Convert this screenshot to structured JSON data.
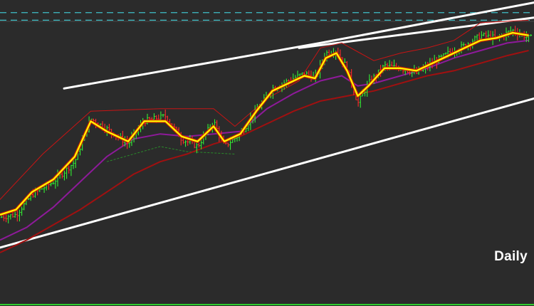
{
  "chart": {
    "timeframe": "Daily",
    "colors": {
      "background": "#2b2b2b",
      "frame": "#4a4a4a",
      "bottom_rule": "#2ecc2e",
      "up_bar": "#33ee33",
      "down_bar": "#ff2a2a",
      "ma_fast": "#ffff00",
      "ma_fast_edge": "#cc2200",
      "ma_mid": "#8e1a9a",
      "ma_slow": "#a01010",
      "envelope": "#c81414",
      "envelope_low": "#2a8a2a",
      "level_line": "#3fc0c8",
      "trend_line": "#ffffff"
    }
  },
  "chart_data": {
    "type": "line",
    "title": "",
    "xlabel": "",
    "ylabel": "",
    "xlim": [
      0,
      100
    ],
    "ylim": [
      0,
      100
    ],
    "grid": false,
    "legend": "none",
    "series": [
      {
        "role": "price",
        "points": [
          [
            0,
            14
          ],
          [
            3,
            15
          ],
          [
            6,
            23
          ],
          [
            10,
            28
          ],
          [
            14,
            36
          ],
          [
            17,
            53
          ],
          [
            20,
            49
          ],
          [
            24,
            43
          ],
          [
            27,
            52
          ],
          [
            31,
            54
          ],
          [
            34,
            45
          ],
          [
            37,
            42
          ],
          [
            40,
            52
          ],
          [
            42,
            42
          ],
          [
            45,
            47
          ],
          [
            48,
            56
          ],
          [
            51,
            65
          ],
          [
            54,
            68
          ],
          [
            57,
            71
          ],
          [
            59,
            69
          ],
          [
            61,
            79
          ],
          [
            63,
            80
          ],
          [
            65,
            73
          ],
          [
            67,
            59
          ],
          [
            69,
            67
          ],
          [
            72,
            74
          ],
          [
            75,
            73
          ],
          [
            78,
            71
          ],
          [
            81,
            75
          ],
          [
            84,
            79
          ],
          [
            87,
            82
          ],
          [
            90,
            86
          ],
          [
            93,
            85
          ],
          [
            96,
            88
          ],
          [
            99,
            85
          ]
        ]
      },
      {
        "role": "ma-fast",
        "points": [
          [
            0,
            15
          ],
          [
            3,
            17
          ],
          [
            6,
            24
          ],
          [
            10,
            29
          ],
          [
            14,
            38
          ],
          [
            17,
            52
          ],
          [
            20,
            48
          ],
          [
            24,
            44
          ],
          [
            27,
            52
          ],
          [
            31,
            52
          ],
          [
            34,
            46
          ],
          [
            37,
            44
          ],
          [
            40,
            50
          ],
          [
            42,
            44
          ],
          [
            45,
            47
          ],
          [
            48,
            56
          ],
          [
            51,
            64
          ],
          [
            54,
            67
          ],
          [
            57,
            70
          ],
          [
            59,
            69
          ],
          [
            61,
            77
          ],
          [
            63,
            79
          ],
          [
            65,
            72
          ],
          [
            67,
            62
          ],
          [
            69,
            66
          ],
          [
            72,
            73
          ],
          [
            75,
            73
          ],
          [
            78,
            72
          ],
          [
            81,
            75
          ],
          [
            84,
            78
          ],
          [
            87,
            81
          ],
          [
            90,
            84
          ],
          [
            93,
            85
          ],
          [
            96,
            87
          ],
          [
            99,
            86
          ]
        ]
      },
      {
        "role": "ma-mid",
        "points": [
          [
            0,
            5
          ],
          [
            5,
            10
          ],
          [
            10,
            18
          ],
          [
            15,
            28
          ],
          [
            20,
            38
          ],
          [
            25,
            45
          ],
          [
            30,
            47
          ],
          [
            35,
            46
          ],
          [
            40,
            47
          ],
          [
            45,
            48
          ],
          [
            50,
            57
          ],
          [
            55,
            63
          ],
          [
            60,
            68
          ],
          [
            64,
            70
          ],
          [
            67,
            66
          ],
          [
            70,
            67
          ],
          [
            75,
            70
          ],
          [
            80,
            73
          ],
          [
            85,
            77
          ],
          [
            90,
            80
          ],
          [
            95,
            83
          ],
          [
            99,
            84
          ]
        ]
      },
      {
        "role": "ma-slow",
        "points": [
          [
            0,
            0
          ],
          [
            5,
            5
          ],
          [
            10,
            11
          ],
          [
            15,
            17
          ],
          [
            20,
            24
          ],
          [
            25,
            31
          ],
          [
            30,
            36
          ],
          [
            35,
            39
          ],
          [
            40,
            43
          ],
          [
            45,
            46
          ],
          [
            50,
            51
          ],
          [
            55,
            56
          ],
          [
            60,
            60
          ],
          [
            65,
            62
          ],
          [
            70,
            64
          ],
          [
            75,
            67
          ],
          [
            80,
            70
          ],
          [
            85,
            72
          ],
          [
            90,
            75
          ],
          [
            95,
            78
          ],
          [
            99,
            80
          ]
        ]
      },
      {
        "role": "envelope-high",
        "points": [
          [
            0,
            21
          ],
          [
            8,
            39
          ],
          [
            17,
            56
          ],
          [
            30,
            57
          ],
          [
            40,
            57
          ],
          [
            44,
            50
          ],
          [
            50,
            61
          ],
          [
            56,
            68
          ],
          [
            60,
            81
          ],
          [
            64,
            83
          ],
          [
            70,
            76
          ],
          [
            75,
            79
          ],
          [
            80,
            81
          ],
          [
            85,
            84
          ],
          [
            90,
            91
          ],
          [
            99,
            92
          ]
        ]
      },
      {
        "role": "envelope-low",
        "points": [
          [
            20,
            36
          ],
          [
            30,
            42
          ],
          [
            35,
            40
          ],
          [
            44,
            39
          ]
        ]
      },
      {
        "role": "upper-trend",
        "points": [
          [
            12,
            65
          ],
          [
            60,
            83
          ],
          [
            100,
            99
          ]
        ]
      },
      {
        "role": "upper-trend-2",
        "points": [
          [
            56,
            81
          ],
          [
            100,
            93
          ]
        ]
      },
      {
        "role": "lower-trend",
        "points": [
          [
            0,
            2
          ],
          [
            100,
            61
          ]
        ]
      }
    ],
    "levels": [
      95,
      92
    ]
  }
}
